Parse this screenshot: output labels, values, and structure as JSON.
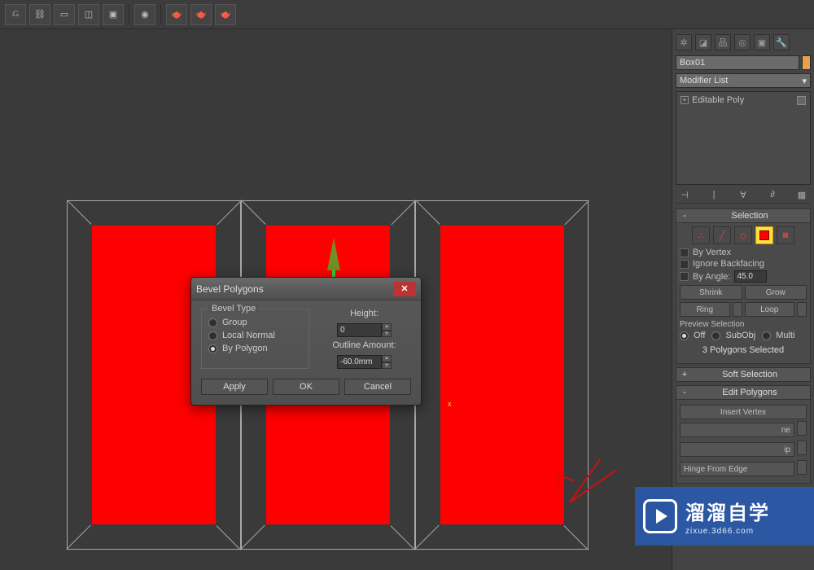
{
  "object_name": "Box01",
  "modifier_dropdown": "Modifier List",
  "modifier_stack": {
    "item": "Editable Poly"
  },
  "dialog": {
    "title": "Bevel Polygons",
    "fieldset": "Bevel Type",
    "opt_group": "Group",
    "opt_local": "Local Normal",
    "opt_poly": "By Polygon",
    "height_label": "Height:",
    "height_value": "0",
    "outline_label": "Outline Amount:",
    "outline_value": "-60.0mm",
    "apply": "Apply",
    "ok": "OK",
    "cancel": "Cancel"
  },
  "selection": {
    "header": "Selection",
    "by_vertex": "By Vertex",
    "ignore_backfacing": "Ignore Backfacing",
    "by_angle": "By Angle:",
    "angle_value": "45.0",
    "shrink": "Shrink",
    "grow": "Grow",
    "ring": "Ring",
    "loop": "Loop",
    "preview_label": "Preview Selection",
    "off": "Off",
    "subobj": "SubObj",
    "multi": "Multi",
    "status": "3 Polygons Selected"
  },
  "soft_selection_header": "Soft Selection",
  "edit_polygons": {
    "header": "Edit Polygons",
    "insert_vertex": "Insert Vertex",
    "hinge": "Hinge From Edge",
    "btn_ne": "ne",
    "btn_ip": "ip"
  },
  "watermark": {
    "line1": "溜溜自学",
    "line2": "zixue.3d66.com"
  },
  "axis_x": "x"
}
